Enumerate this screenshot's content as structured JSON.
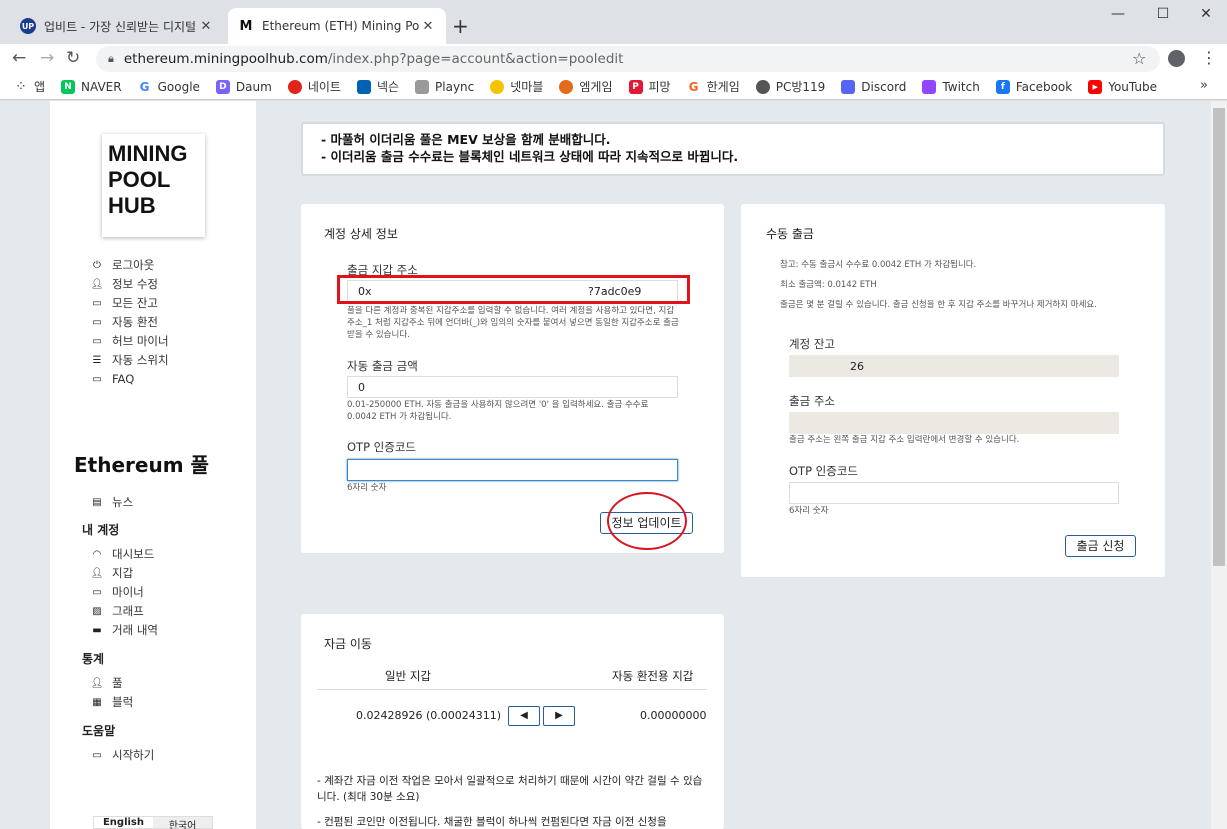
{
  "browser": {
    "tab1_title": "업비트 - 가장 신뢰받는 디지털 자산 거래소",
    "tab2_title": "Ethereum (ETH) Mining Pool Hub",
    "url_host": "ethereum.miningpoolhub.com",
    "url_path": "/index.php?page=account&action=pooledit",
    "bookmarks": [
      "앱",
      "NAVER",
      "Google",
      "Daum",
      "네이트",
      "넥슨",
      "Plaync",
      "넷마블",
      "엠게임",
      "피망",
      "한게임",
      "PC방119",
      "Discord",
      "Twitch",
      "Facebook",
      "YouTube"
    ],
    "bookmark_overflow": "»"
  },
  "sidebar": {
    "logo": [
      "MINING",
      "POOL",
      "HUB"
    ],
    "account_links": [
      "로그아웃",
      "정보 수정",
      "모든 잔고",
      "자동 환전",
      "허브 마이너",
      "자동 스위치",
      "FAQ"
    ],
    "pool_title": "Ethereum 풀",
    "news": "뉴스",
    "my_account_heading": "내 계정",
    "my_account_links": [
      "대시보드",
      "지갑",
      "마이너",
      "그래프",
      "거래 내역"
    ],
    "stats_heading": "통계",
    "stats_links": [
      "풀",
      "블럭"
    ],
    "help_heading": "도움말",
    "help_links": [
      "시작하기"
    ],
    "languages": [
      "English",
      "한국어"
    ]
  },
  "notice": {
    "line1": "- 마풀허 이더리움 풀은 MEV 보상을 함께 분배합니다.",
    "line2": "- 이더리움 출금 수수료는 블록체인 네트워크 상태에 따라 지속적으로 바뀝니다."
  },
  "account_details": {
    "title": "계정 상세 정보",
    "address_label": "출금 지갑 주소",
    "address_prefix": "0x",
    "address_suffix": "?7adc0e9",
    "address_help": "풀을 다른 계정과 중복된 지갑주소를 입력할 수 없습니다. 여러 계정을 사용하고 있다면, 지갑주소_1 처럼 지갑주소 뒤에 언더바(_)와 임의의 숫자를 붙여서 넣으면 동일한 지갑주소로 출금받을 수 있습니다.",
    "auto_amount_label": "자동 출금 금액",
    "auto_amount_value": "0",
    "auto_amount_help": "0.01-250000 ETH. 자동 출금을 사용하지 않으려면 '0' 을 입력하세요. 출금 수수료 0.0042 ETH 가 차감됩니다.",
    "otp_label": "OTP 인증코드",
    "otp_help": "6자리 숫자",
    "update_button": "정보 업데이트"
  },
  "manual_withdraw": {
    "title": "수동 출금",
    "note1": "참고: 수동 출금시 수수료 0.0042 ETH 가 차감됩니다.",
    "note2": "최소 출금액: 0.0142 ETH",
    "note3": "출금은 몇 분 걸릴 수 있습니다. 출금 신청을 한 후 지갑 주소를 바꾸거나 제거하지 마세요.",
    "balance_label": "계정 잔고",
    "balance_value": "26",
    "address_label": "출금 주소",
    "address_help": "출금 주소는 왼쪽 출금 지갑 주소 입력란에서 변경할 수 있습니다.",
    "otp_label": "OTP 인증코드",
    "otp_help": "6자리 숫자",
    "button": "출금 신청"
  },
  "fund_transfer": {
    "title": "자금 이동",
    "col_general": "일반 지갑",
    "col_auto": "자동 환전용 지갑",
    "general_value": "0.02428926 (0.00024311)",
    "auto_value": "0.00000000",
    "left_arrow": "◀",
    "right_arrow": "▶",
    "note1": "- 계좌간 자금 이전 작업은 모아서 일괄적으로 처리하기 때문에 시간이 약간 걸릴 수 있습니다. (최대 30분 소요)",
    "note2": "- 컨펌된 코인만 이전됩니다. 채굴한 블럭이 하나씩 컨펌된다면 자금 이전 신청을"
  }
}
